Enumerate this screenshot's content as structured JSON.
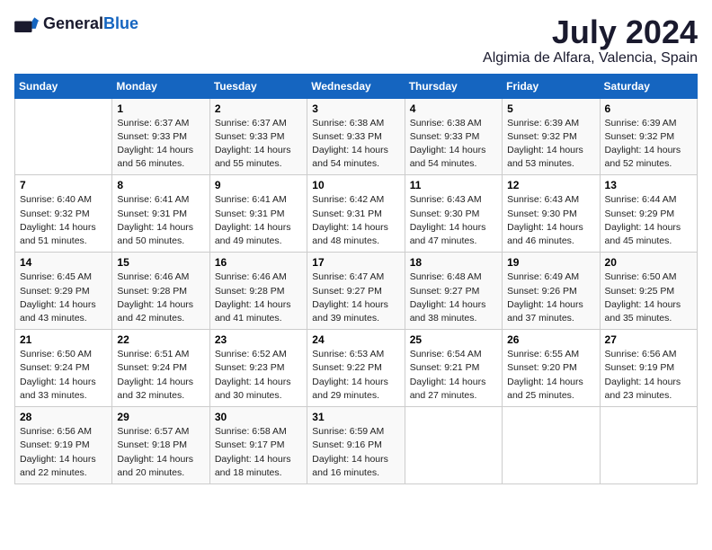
{
  "logo": {
    "general": "General",
    "blue": "Blue"
  },
  "title": "July 2024",
  "subtitle": "Algimia de Alfara, Valencia, Spain",
  "weekdays": [
    "Sunday",
    "Monday",
    "Tuesday",
    "Wednesday",
    "Thursday",
    "Friday",
    "Saturday"
  ],
  "weeks": [
    [
      {
        "day": "",
        "detail": ""
      },
      {
        "day": "1",
        "detail": "Sunrise: 6:37 AM\nSunset: 9:33 PM\nDaylight: 14 hours\nand 56 minutes."
      },
      {
        "day": "2",
        "detail": "Sunrise: 6:37 AM\nSunset: 9:33 PM\nDaylight: 14 hours\nand 55 minutes."
      },
      {
        "day": "3",
        "detail": "Sunrise: 6:38 AM\nSunset: 9:33 PM\nDaylight: 14 hours\nand 54 minutes."
      },
      {
        "day": "4",
        "detail": "Sunrise: 6:38 AM\nSunset: 9:33 PM\nDaylight: 14 hours\nand 54 minutes."
      },
      {
        "day": "5",
        "detail": "Sunrise: 6:39 AM\nSunset: 9:32 PM\nDaylight: 14 hours\nand 53 minutes."
      },
      {
        "day": "6",
        "detail": "Sunrise: 6:39 AM\nSunset: 9:32 PM\nDaylight: 14 hours\nand 52 minutes."
      }
    ],
    [
      {
        "day": "7",
        "detail": "Sunrise: 6:40 AM\nSunset: 9:32 PM\nDaylight: 14 hours\nand 51 minutes."
      },
      {
        "day": "8",
        "detail": "Sunrise: 6:41 AM\nSunset: 9:31 PM\nDaylight: 14 hours\nand 50 minutes."
      },
      {
        "day": "9",
        "detail": "Sunrise: 6:41 AM\nSunset: 9:31 PM\nDaylight: 14 hours\nand 49 minutes."
      },
      {
        "day": "10",
        "detail": "Sunrise: 6:42 AM\nSunset: 9:31 PM\nDaylight: 14 hours\nand 48 minutes."
      },
      {
        "day": "11",
        "detail": "Sunrise: 6:43 AM\nSunset: 9:30 PM\nDaylight: 14 hours\nand 47 minutes."
      },
      {
        "day": "12",
        "detail": "Sunrise: 6:43 AM\nSunset: 9:30 PM\nDaylight: 14 hours\nand 46 minutes."
      },
      {
        "day": "13",
        "detail": "Sunrise: 6:44 AM\nSunset: 9:29 PM\nDaylight: 14 hours\nand 45 minutes."
      }
    ],
    [
      {
        "day": "14",
        "detail": "Sunrise: 6:45 AM\nSunset: 9:29 PM\nDaylight: 14 hours\nand 43 minutes."
      },
      {
        "day": "15",
        "detail": "Sunrise: 6:46 AM\nSunset: 9:28 PM\nDaylight: 14 hours\nand 42 minutes."
      },
      {
        "day": "16",
        "detail": "Sunrise: 6:46 AM\nSunset: 9:28 PM\nDaylight: 14 hours\nand 41 minutes."
      },
      {
        "day": "17",
        "detail": "Sunrise: 6:47 AM\nSunset: 9:27 PM\nDaylight: 14 hours\nand 39 minutes."
      },
      {
        "day": "18",
        "detail": "Sunrise: 6:48 AM\nSunset: 9:27 PM\nDaylight: 14 hours\nand 38 minutes."
      },
      {
        "day": "19",
        "detail": "Sunrise: 6:49 AM\nSunset: 9:26 PM\nDaylight: 14 hours\nand 37 minutes."
      },
      {
        "day": "20",
        "detail": "Sunrise: 6:50 AM\nSunset: 9:25 PM\nDaylight: 14 hours\nand 35 minutes."
      }
    ],
    [
      {
        "day": "21",
        "detail": "Sunrise: 6:50 AM\nSunset: 9:24 PM\nDaylight: 14 hours\nand 33 minutes."
      },
      {
        "day": "22",
        "detail": "Sunrise: 6:51 AM\nSunset: 9:24 PM\nDaylight: 14 hours\nand 32 minutes."
      },
      {
        "day": "23",
        "detail": "Sunrise: 6:52 AM\nSunset: 9:23 PM\nDaylight: 14 hours\nand 30 minutes."
      },
      {
        "day": "24",
        "detail": "Sunrise: 6:53 AM\nSunset: 9:22 PM\nDaylight: 14 hours\nand 29 minutes."
      },
      {
        "day": "25",
        "detail": "Sunrise: 6:54 AM\nSunset: 9:21 PM\nDaylight: 14 hours\nand 27 minutes."
      },
      {
        "day": "26",
        "detail": "Sunrise: 6:55 AM\nSunset: 9:20 PM\nDaylight: 14 hours\nand 25 minutes."
      },
      {
        "day": "27",
        "detail": "Sunrise: 6:56 AM\nSunset: 9:19 PM\nDaylight: 14 hours\nand 23 minutes."
      }
    ],
    [
      {
        "day": "28",
        "detail": "Sunrise: 6:56 AM\nSunset: 9:19 PM\nDaylight: 14 hours\nand 22 minutes."
      },
      {
        "day": "29",
        "detail": "Sunrise: 6:57 AM\nSunset: 9:18 PM\nDaylight: 14 hours\nand 20 minutes."
      },
      {
        "day": "30",
        "detail": "Sunrise: 6:58 AM\nSunset: 9:17 PM\nDaylight: 14 hours\nand 18 minutes."
      },
      {
        "day": "31",
        "detail": "Sunrise: 6:59 AM\nSunset: 9:16 PM\nDaylight: 14 hours\nand 16 minutes."
      },
      {
        "day": "",
        "detail": ""
      },
      {
        "day": "",
        "detail": ""
      },
      {
        "day": "",
        "detail": ""
      }
    ]
  ]
}
